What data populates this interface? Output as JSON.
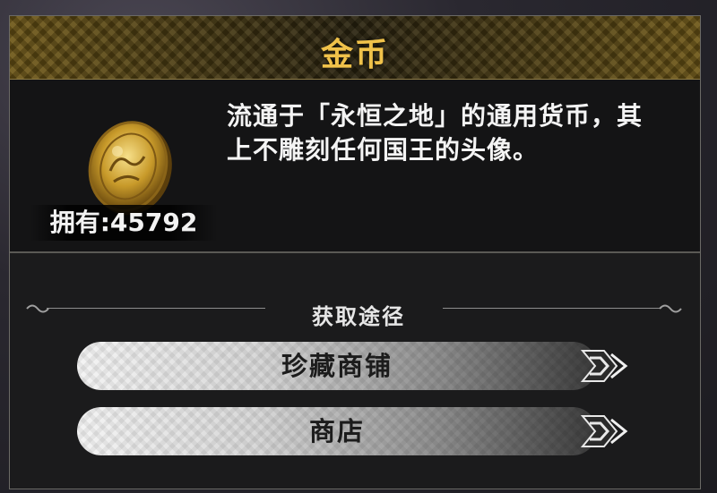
{
  "item": {
    "title": "金币",
    "description_line1": "流通于「永恒之地」的通用货币，其",
    "description_line2": "上不雕刻任何国王的头像。",
    "owned_text": "拥有:45792",
    "icon": "gold-coin-icon"
  },
  "obtain": {
    "section_title": "获取途径",
    "routes": [
      {
        "label": "珍藏商铺",
        "icon": "arrow-ornament-icon"
      },
      {
        "label": "商店",
        "icon": "arrow-ornament-icon"
      }
    ]
  },
  "colors": {
    "title_gold": "#f0c24a",
    "panel_bg": "#161617"
  }
}
